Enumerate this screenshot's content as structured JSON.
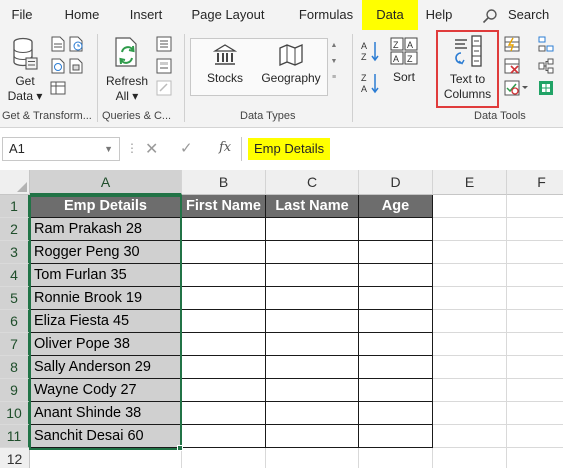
{
  "menu": {
    "tabs": [
      {
        "label": "File"
      },
      {
        "label": "Home"
      },
      {
        "label": "Insert"
      },
      {
        "label": "Page Layout"
      },
      {
        "label": "Formulas"
      },
      {
        "label": "Data"
      },
      {
        "label": "Help"
      }
    ],
    "active_tab": "Data",
    "search_label": "Search"
  },
  "ribbon": {
    "get_data": {
      "line1": "Get",
      "line2": "Data ▾"
    },
    "refresh_all": {
      "line1": "Refresh",
      "line2": "All ▾"
    },
    "stocks_label": "Stocks",
    "geography_label": "Geography",
    "sort_label": "Sort",
    "text_to_columns": {
      "line1": "Text to",
      "line2": "Columns"
    },
    "groups": {
      "get_transform": "Get & Transform...",
      "queries": "Queries & C...",
      "data_types": "Data Types",
      "data_tools": "Data Tools"
    }
  },
  "formula_bar": {
    "name_box": "A1",
    "fx": "fx",
    "content": "Emp Details"
  },
  "sheet": {
    "columns": [
      "A",
      "B",
      "C",
      "D",
      "E",
      "F"
    ],
    "rows": [
      "1",
      "2",
      "3",
      "4",
      "5",
      "6",
      "7",
      "8",
      "9",
      "10",
      "11",
      "12"
    ],
    "headers": [
      "Emp Details",
      "First Name",
      "Last Name",
      "Age"
    ],
    "emp_details": [
      "Ram Prakash 28",
      "Rogger Peng 30",
      "Tom Furlan 35",
      "Ronnie Brook 19",
      "Eliza Fiesta 45",
      "Oliver Pope 38",
      "Sally Anderson 29",
      "Wayne Cody 27",
      "Anant Shinde 38",
      "Sanchit Desai 60"
    ],
    "selected_cell": "A1"
  },
  "colors": {
    "active_tab_highlight": "#ffff00",
    "header_fill": "#6d6d6d",
    "column_a_fill": "#d0d0d0",
    "selection_border": "#217346",
    "ttc_highlight_border": "#e03b3b"
  }
}
